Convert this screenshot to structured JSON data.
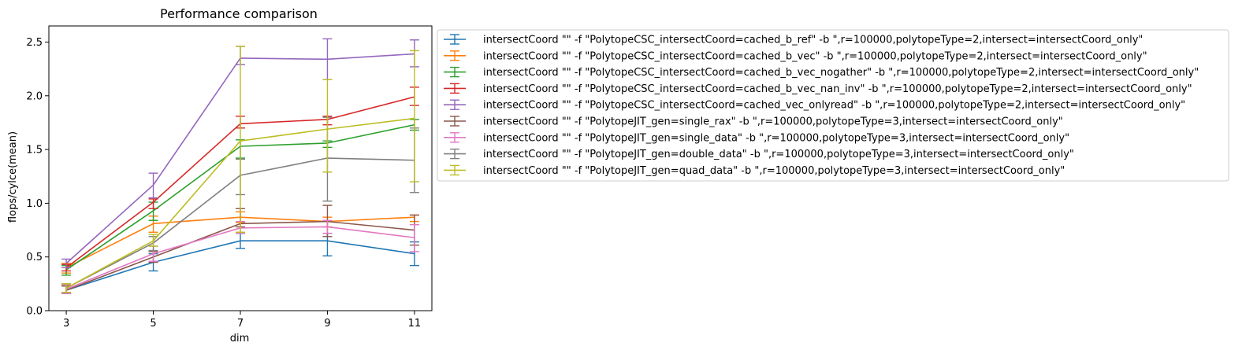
{
  "chart_data": {
    "type": "line",
    "title": "Performance comparison",
    "xlabel": "dim",
    "ylabel": "flops/cylce(mean)",
    "x": [
      3,
      5,
      7,
      9,
      11
    ],
    "xticks": [
      3,
      5,
      7,
      9,
      11
    ],
    "xlim": [
      2.6,
      11.4
    ],
    "ylim": [
      0.0,
      2.65
    ],
    "yticks": [
      0.0,
      0.5,
      1.0,
      1.5,
      2.0,
      2.5
    ],
    "ytick_labels": [
      "0.0",
      "0.5",
      "1.0",
      "1.5",
      "2.0",
      "2.5"
    ],
    "grid": false,
    "legend_position": "outside-right-top",
    "error_bars": true,
    "series": [
      {
        "name": "intersectCoord \"\" -f \"PolytopeCSC_intersectCoord=cached_b_ref\" -b \",r=100000,polytopeType=2,intersect=intersectCoord_only\"",
        "color": "#1f77b4",
        "values": [
          0.19,
          0.45,
          0.65,
          0.65,
          0.53
        ],
        "err_low": [
          0.16,
          0.37,
          0.58,
          0.51,
          0.42
        ],
        "err_high": [
          0.23,
          0.53,
          0.72,
          0.72,
          0.64
        ]
      },
      {
        "name": "intersectCoord \"\" -f \"PolytopeCSC_intersectCoord=cached_b_vec\" -b \",r=100000,polytopeType=2,intersect=intersectCoord_only\"",
        "color": "#ff7f0e",
        "values": [
          0.4,
          0.81,
          0.87,
          0.83,
          0.87
        ],
        "err_low": [
          0.35,
          0.73,
          0.82,
          0.78,
          0.83
        ],
        "err_high": [
          0.44,
          0.88,
          0.92,
          0.87,
          0.89
        ]
      },
      {
        "name": "intersectCoord \"\" -f \"PolytopeCSC_intersectCoord=cached_b_vec_nogather\" -b \",r=100000,polytopeType=2,intersect=intersectCoord_only\"",
        "color": "#2ca02c",
        "values": [
          0.38,
          0.93,
          1.53,
          1.56,
          1.73
        ],
        "err_low": [
          0.33,
          0.84,
          1.42,
          1.52,
          1.68
        ],
        "err_high": [
          0.42,
          1.01,
          1.59,
          1.58,
          1.78
        ]
      },
      {
        "name": "intersectCoord \"\" -f \"PolytopeCSC_intersectCoord=cached_b_vec_nan_inv\" -b \",r=100000,polytopeType=2,intersect=intersectCoord_only\"",
        "color": "#d62728",
        "values": [
          0.4,
          1.01,
          1.74,
          1.78,
          1.99
        ],
        "err_low": [
          0.37,
          0.95,
          1.7,
          1.73,
          1.91
        ],
        "err_high": [
          0.43,
          1.04,
          1.81,
          1.81,
          2.08
        ]
      },
      {
        "name": "intersectCoord \"\" -f \"PolytopeCSC_intersectCoord=cached_vec_onlyread\" -b \",r=100000,polytopeType=2,intersect=intersectCoord_only\"",
        "color": "#9467bd",
        "values": [
          0.44,
          1.17,
          2.35,
          2.34,
          2.39
        ],
        "err_low": [
          0.4,
          1.05,
          2.29,
          2.15,
          2.27
        ],
        "err_high": [
          0.48,
          1.28,
          2.46,
          2.53,
          2.52
        ]
      },
      {
        "name": "intersectCoord \"\" -f \"PolytopeJIT_gen=single_rax\" -b \",r=100000,polytopeType=3,intersect=intersectCoord_only\"",
        "color": "#8c564b",
        "values": [
          0.19,
          0.5,
          0.81,
          0.83,
          0.75
        ],
        "err_low": [
          0.16,
          0.45,
          0.78,
          0.69,
          0.61
        ],
        "err_high": [
          0.23,
          0.55,
          0.95,
          0.98,
          0.89
        ]
      },
      {
        "name": "intersectCoord \"\" -f \"PolytopeJIT_gen=single_data\" -b \",r=100000,polytopeType=3,intersect=intersectCoord_only\"",
        "color": "#e377c2",
        "values": [
          0.2,
          0.53,
          0.77,
          0.78,
          0.68
        ],
        "err_low": [
          0.16,
          0.46,
          0.72,
          0.72,
          0.55
        ],
        "err_high": [
          0.24,
          0.6,
          0.83,
          0.84,
          0.8
        ]
      },
      {
        "name": "intersectCoord \"\" -f \"PolytopeJIT_gen=double_data\" -b \",r=100000,polytopeType=3,intersect=intersectCoord_only\"",
        "color": "#7f7f7f",
        "values": [
          0.21,
          0.63,
          1.26,
          1.42,
          1.4
        ],
        "err_low": [
          0.17,
          0.56,
          1.08,
          1.02,
          1.1
        ],
        "err_high": [
          0.25,
          0.69,
          1.41,
          1.8,
          1.7
        ]
      },
      {
        "name": "intersectCoord \"\" -f \"PolytopeJIT_gen=quad_data\" -b \",r=100000,polytopeType=3,intersect=intersectCoord_only\"",
        "color": "#bcbd22",
        "values": [
          0.21,
          0.65,
          1.58,
          1.69,
          1.79
        ],
        "err_low": [
          0.17,
          0.6,
          0.73,
          1.29,
          1.2
        ],
        "err_high": [
          0.25,
          0.71,
          2.46,
          2.15,
          2.42
        ]
      }
    ]
  }
}
